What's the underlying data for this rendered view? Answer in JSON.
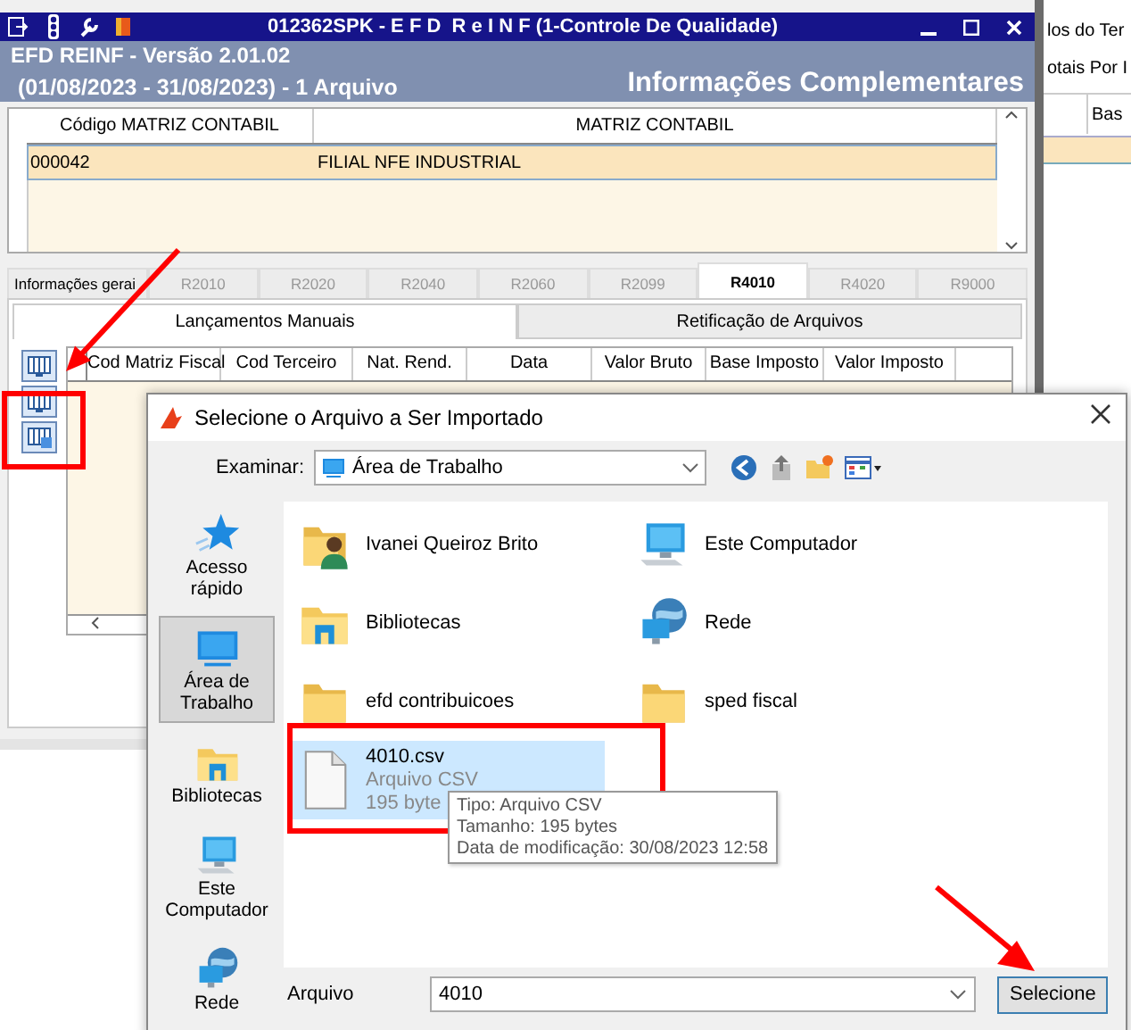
{
  "background_window": {
    "texts": [
      "los do Ter",
      "otais Por I"
    ],
    "column_header": "Bas"
  },
  "window": {
    "title": "012362SPK - E F D  R e I N F (1-Controle De Qualidade)"
  },
  "header": {
    "version": "EFD REINF - Versão 2.01.02",
    "period": "(01/08/2023 - 31/08/2023) - 1 Arquivo",
    "section": "Informações Complementares"
  },
  "matrix_table": {
    "columns": [
      "Código MATRIZ CONTABIL",
      "MATRIZ CONTABIL"
    ],
    "rows": [
      {
        "cells": [
          "000042",
          "FILIAL NFE INDUSTRIAL"
        ],
        "selected": true
      }
    ]
  },
  "tabs": [
    {
      "label": "Informações gerai",
      "selected": false
    },
    {
      "label": "R2010",
      "selected": false
    },
    {
      "label": "R2020",
      "selected": false
    },
    {
      "label": "R2040",
      "selected": false
    },
    {
      "label": "R2060",
      "selected": false
    },
    {
      "label": "R2099",
      "selected": false
    },
    {
      "label": "R4010",
      "selected": true
    },
    {
      "label": "R4020",
      "selected": false
    },
    {
      "label": "R9000",
      "selected": false
    }
  ],
  "subtabs": [
    {
      "label": "Lançamentos Manuais",
      "selected": true
    },
    {
      "label": "Retificação de Arquivos",
      "selected": false
    }
  ],
  "entries_table": {
    "columns": [
      "Cod Matriz Fiscal",
      "Cod Terceiro",
      "Nat. Rend.",
      "Data",
      "Valor Bruto",
      "Base Imposto",
      "Valor Imposto"
    ]
  },
  "dialog": {
    "title": "Selecione o Arquivo a Ser Importado",
    "look_in_label": "Examinar:",
    "look_in_value": "Área de Trabalho",
    "places": [
      {
        "label": "Acesso rápido",
        "kind": "star",
        "selected": false
      },
      {
        "label": "Área de Trabalho",
        "kind": "desktop",
        "selected": true
      },
      {
        "label": "Bibliotecas",
        "kind": "library",
        "selected": false
      },
      {
        "label": "Este Computador",
        "kind": "computer",
        "selected": false
      },
      {
        "label": "Rede",
        "kind": "network",
        "selected": false
      }
    ],
    "files": [
      {
        "name": "Ivanei Queiroz Brito",
        "kind": "user",
        "selected": false
      },
      {
        "name": "Este Computador",
        "kind": "computer",
        "selected": false
      },
      {
        "name": "Bibliotecas",
        "kind": "library",
        "selected": false
      },
      {
        "name": "Rede",
        "kind": "network",
        "selected": false
      },
      {
        "name": "efd contribuicoes",
        "kind": "folder",
        "selected": false
      },
      {
        "name": "sped fiscal",
        "kind": "folder",
        "selected": false
      },
      {
        "name": "4010.csv",
        "kind": "file",
        "type": "Arquivo CSV",
        "size": "195 byte",
        "selected": true
      }
    ],
    "tooltip": [
      "Tipo: Arquivo CSV",
      "Tamanho: 195 bytes",
      "Data de modificação: 30/08/2023 12:58"
    ],
    "file_label": "Arquivo",
    "file_value": "4010",
    "button": "Selecione"
  }
}
